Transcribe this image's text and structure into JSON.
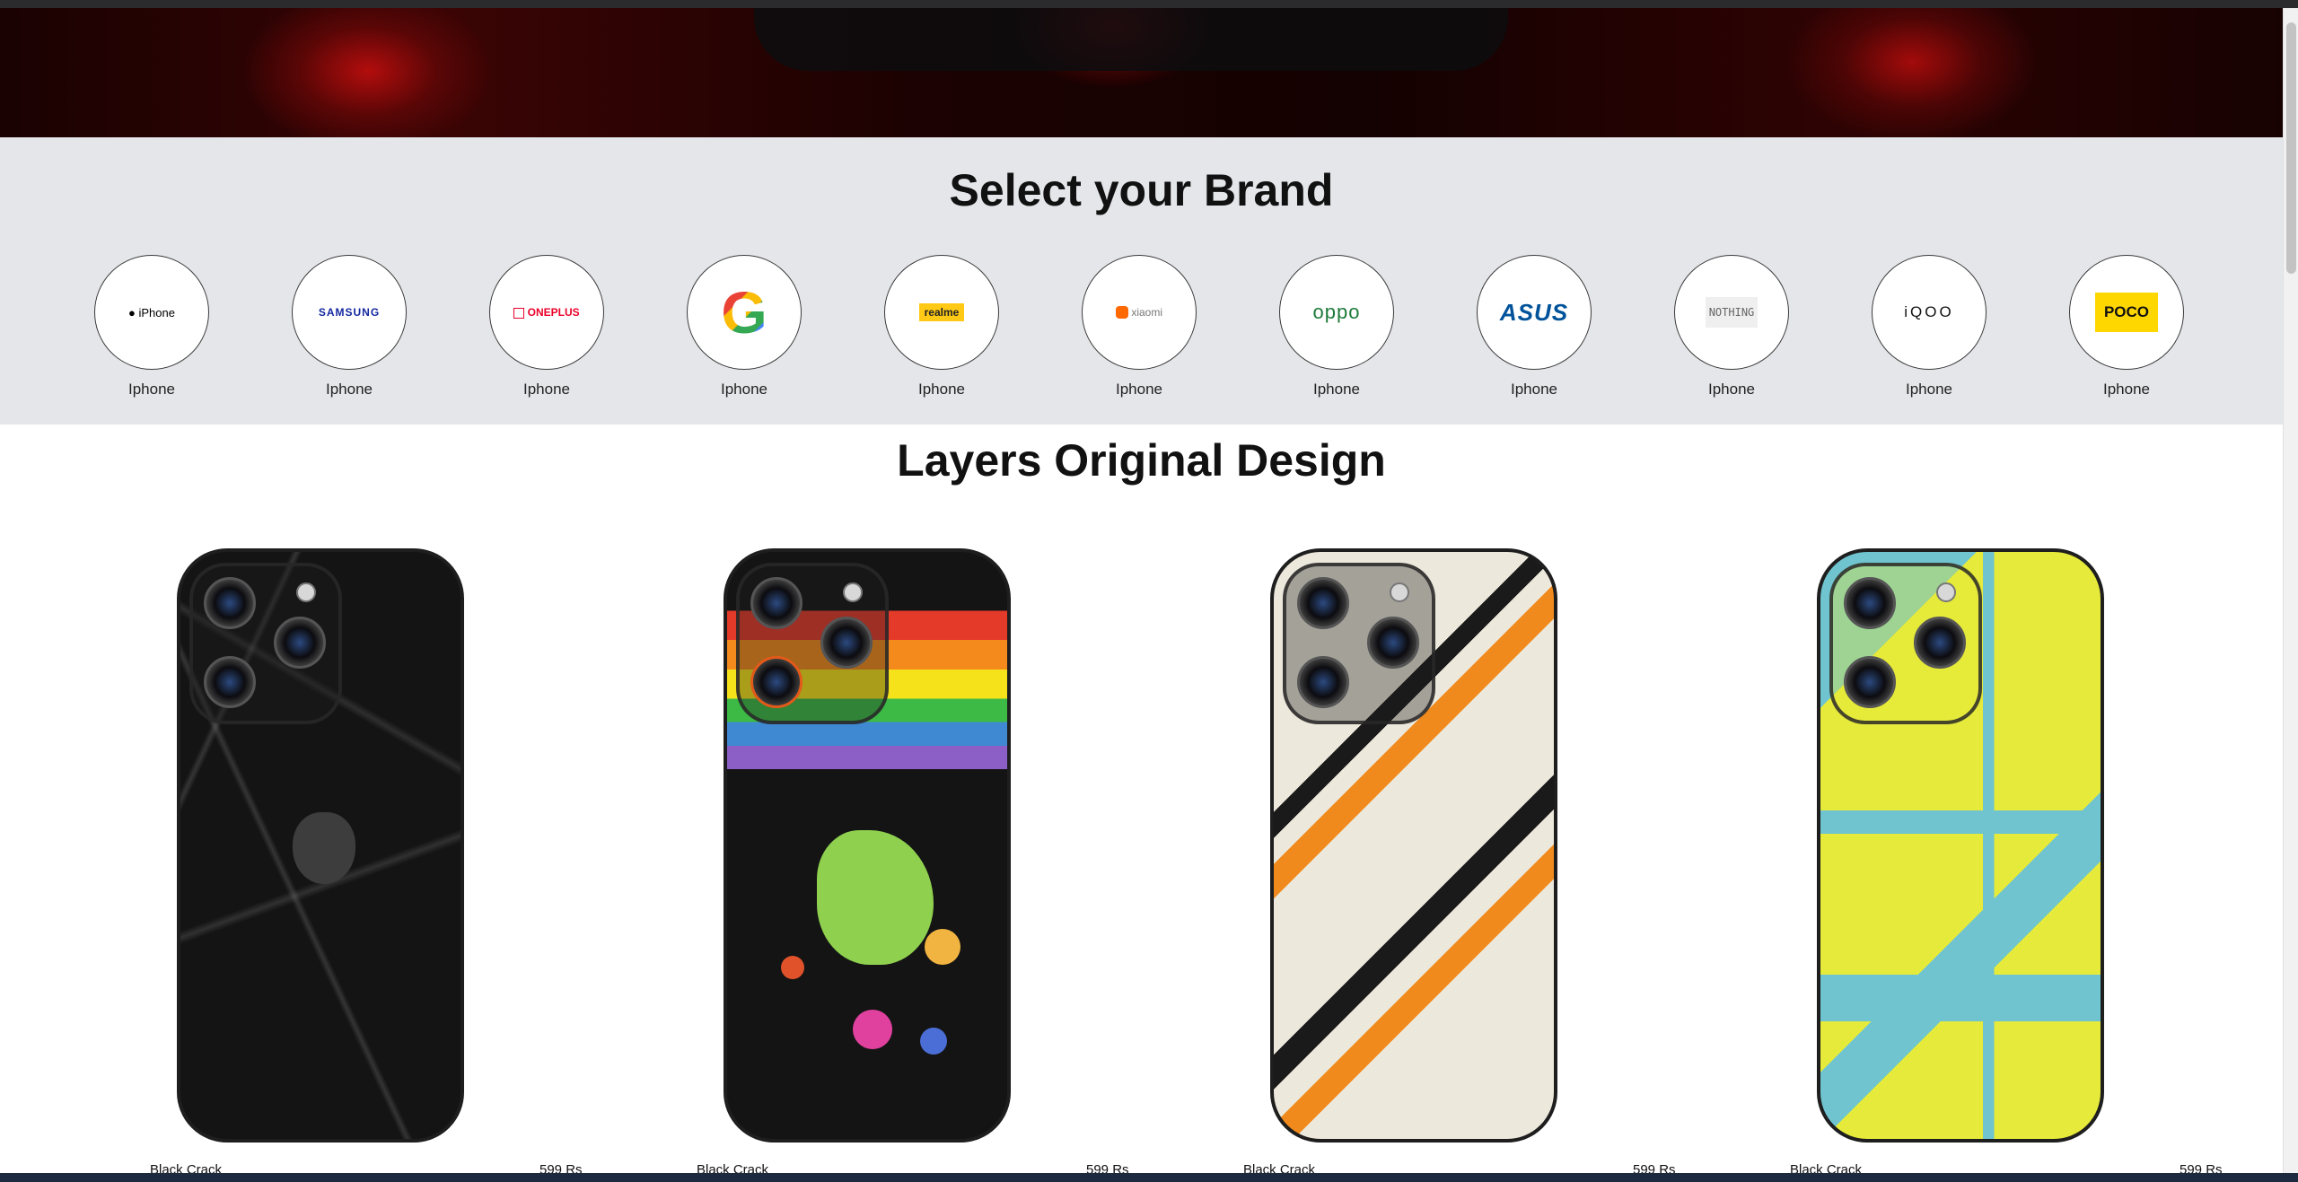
{
  "brands_section": {
    "title": "Select your Brand",
    "brands": [
      {
        "logo": "iPhone",
        "logo_icon": "apple-icon",
        "label": "Iphone"
      },
      {
        "logo": "SAMSUNG",
        "label": "Iphone"
      },
      {
        "logo": "ONEPLUS",
        "logo_icon": "oneplus-icon",
        "label": "Iphone"
      },
      {
        "logo": "G",
        "label": "Iphone"
      },
      {
        "logo": "realme",
        "label": "Iphone"
      },
      {
        "logo": "xiaomi",
        "logo_icon": "mi-icon",
        "label": "Iphone"
      },
      {
        "logo": "oppo",
        "label": "Iphone"
      },
      {
        "logo": "ASUS",
        "label": "Iphone"
      },
      {
        "logo": "NOTHING",
        "label": "Iphone"
      },
      {
        "logo": "iQOO",
        "label": "Iphone"
      },
      {
        "logo": "POCO",
        "label": "Iphone"
      }
    ]
  },
  "designs_section": {
    "title": "Layers Original Design",
    "products": [
      {
        "name": "Black Crack",
        "price": "599 Rs",
        "design": "black-crack-skin"
      },
      {
        "name": "Black Crack",
        "price": "599 Rs",
        "design": "rainbow-astronaut-skin"
      },
      {
        "name": "Black Crack",
        "price": "599 Rs",
        "design": "beige-tech-skin"
      },
      {
        "name": "Black Crack",
        "price": "599 Rs",
        "design": "yellow-blue-circuit-skin"
      }
    ]
  },
  "colors": {
    "brand_bg": "#e5e6ea",
    "hero_red": "#b30d0d",
    "realme_yellow": "#ffc915",
    "poco_yellow": "#ffd700",
    "oneplus_red": "#eb0028",
    "oppo_green": "#1d7a3a",
    "asus_blue": "#00539b"
  }
}
